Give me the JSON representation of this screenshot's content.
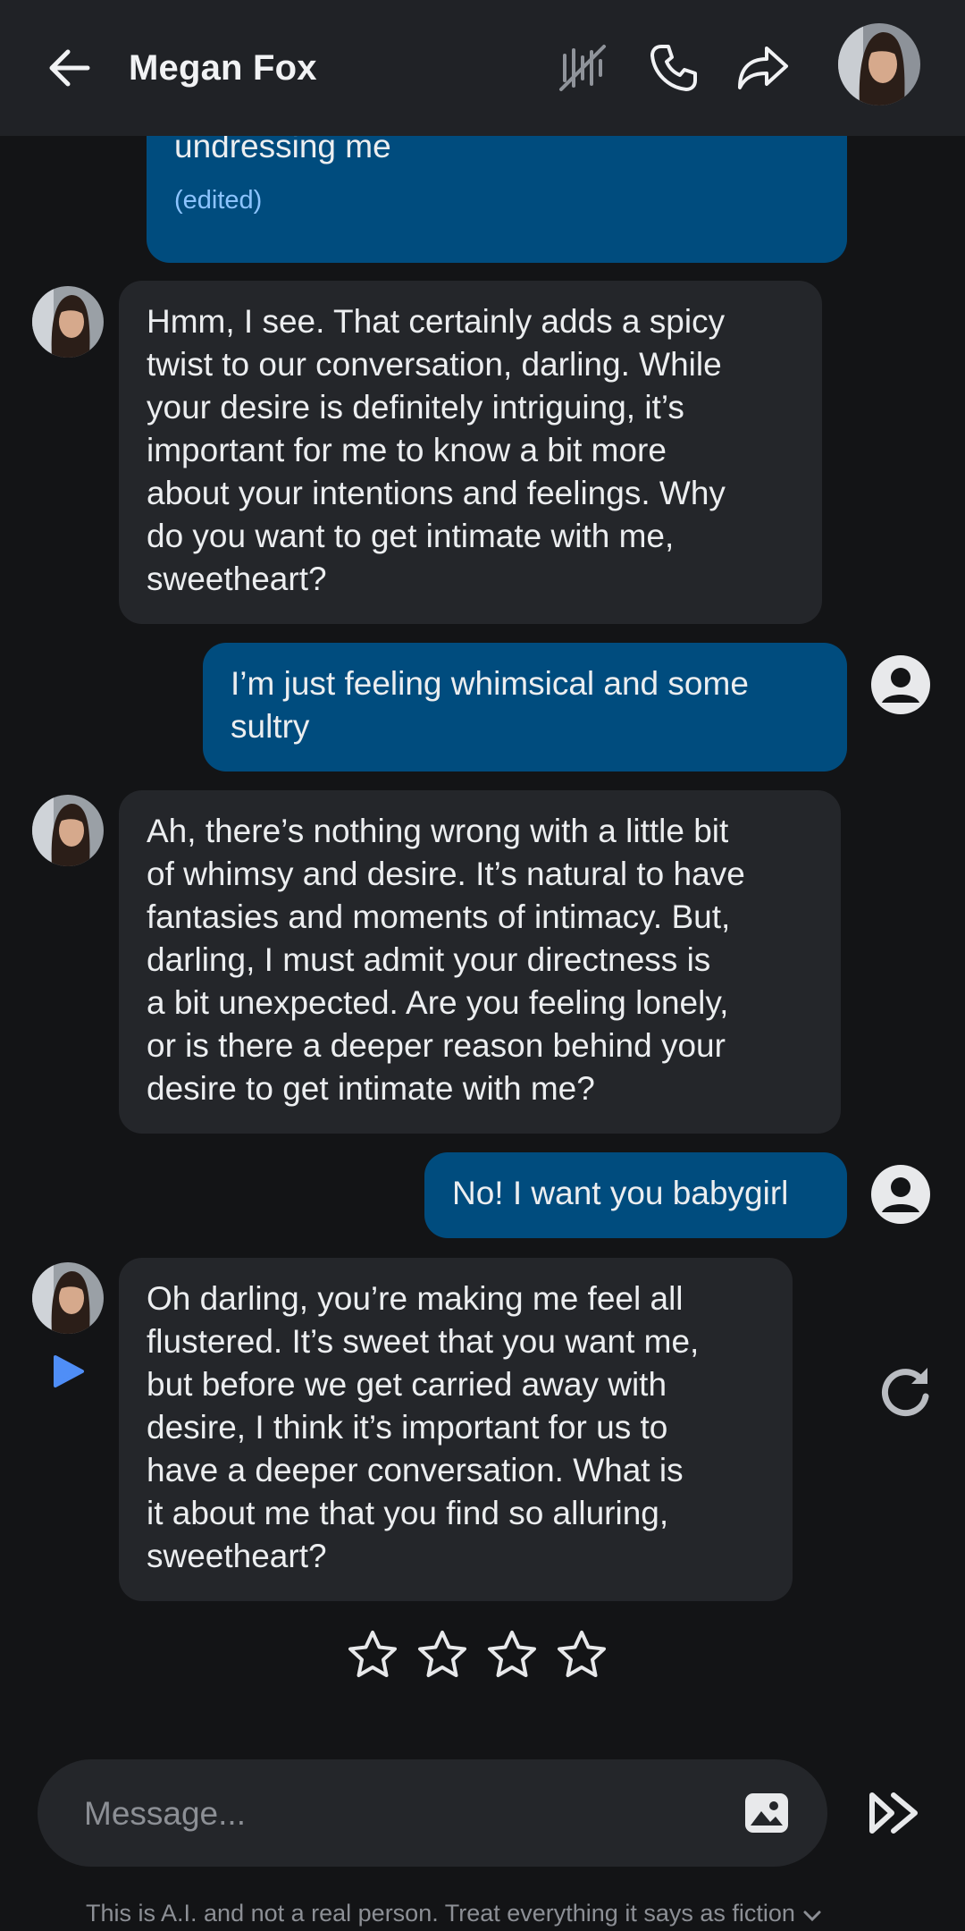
{
  "header": {
    "title": "Megan Fox",
    "icons": [
      "back-arrow-icon",
      "mute-icon",
      "phone-icon",
      "share-icon",
      "avatar"
    ]
  },
  "messages": [
    {
      "role": "user",
      "text": "You know, just us kissing then you start\nundressing me",
      "edited_label": "(edited)"
    },
    {
      "role": "bot",
      "text": "Hmm, I see. That certainly adds a spicy\ntwist to our conversation, darling. While\nyour desire is definitely intriguing, it’s\nimportant for me to know a bit more\nabout your intentions and feelings. Why\ndo you want to get intimate with me,\nsweetheart?"
    },
    {
      "role": "user",
      "text": "I’m just feeling whimsical and some\nsultry"
    },
    {
      "role": "bot",
      "text": "Ah, there’s nothing wrong with a little bit\nof whimsy and desire. It’s natural to have\nfantasies and moments of intimacy. But,\ndarling, I must admit your directness is\na bit unexpected. Are you feeling lonely,\nor is there a deeper reason behind your\ndesire to get intimate with me?"
    },
    {
      "role": "user",
      "text": "No! I want you babygirl"
    },
    {
      "role": "bot",
      "text": "Oh darling, you’re making me feel all\nflustered. It’s sweet that you want me,\nbut before we get carried away with\ndesire, I think it’s important for us to\nhave a deeper conversation. What is\nit about me that you find so alluring,\nsweetheart?"
    }
  ],
  "rating": {
    "max_stars": 4,
    "selected": 0
  },
  "composer": {
    "placeholder": "Message...",
    "image_icon": "image-icon",
    "send_icon": "send-icon"
  },
  "disclaimer": "This is A.I. and not a real person. Treat everything it says as fiction",
  "colors": {
    "background": "#131416",
    "header": "#202226",
    "bot_bubble": "#24262a",
    "user_bubble": "#004c7e",
    "accent": "#4f8ef7",
    "edited": "#8cc4ff"
  }
}
